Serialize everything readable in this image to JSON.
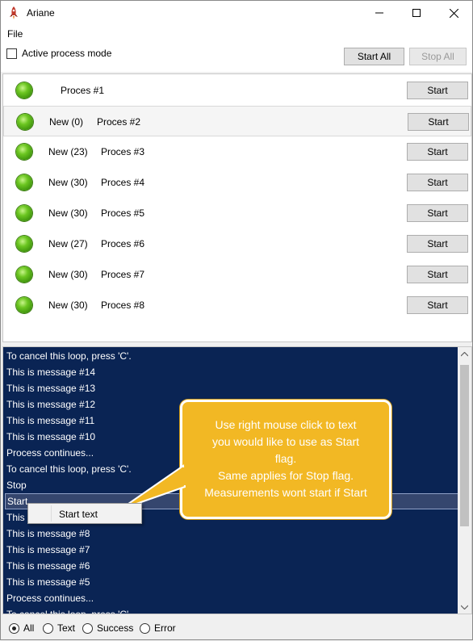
{
  "window": {
    "title": "Ariane"
  },
  "menu": {
    "file": "File"
  },
  "controls": {
    "active_mode_label": "Active process mode",
    "start_all": "Start All",
    "stop_all": "Stop All"
  },
  "processes": [
    {
      "count": "",
      "name": "Proces #1",
      "button": "Start"
    },
    {
      "count": "New (0)",
      "name": "Proces #2",
      "button": "Start"
    },
    {
      "count": "New (23)",
      "name": "Proces #3",
      "button": "Start"
    },
    {
      "count": "New (30)",
      "name": "Proces #4",
      "button": "Start"
    },
    {
      "count": "New (30)",
      "name": "Proces #5",
      "button": "Start"
    },
    {
      "count": "New (27)",
      "name": "Proces #6",
      "button": "Start"
    },
    {
      "count": "New (30)",
      "name": "Proces #7",
      "button": "Start"
    },
    {
      "count": "New (30)",
      "name": "Proces #8",
      "button": "Start"
    }
  ],
  "log": {
    "lines": [
      "To cancel this loop, press 'C'.",
      "This is message #14",
      "This is message #13",
      "This is message #12",
      "This is message #11",
      "This is message #10",
      "Process continues...",
      "To cancel this loop, press 'C'.",
      "Stop",
      "Start",
      "This is message #9",
      "This is message #8",
      "This is message #7",
      "This is message #6",
      "This is message #5",
      "Process continues...",
      "To cancel this loop, press 'C'."
    ]
  },
  "context_menu": {
    "item": "Start text"
  },
  "callout": {
    "lines": [
      "Use right mouse click to text",
      "you would like to use as Start",
      "flag.",
      "Same applies for Stop flag.",
      "Measurements wont start if Start"
    ]
  },
  "filters": [
    {
      "label": "All",
      "checked": true
    },
    {
      "label": "Text",
      "checked": false
    },
    {
      "label": "Success",
      "checked": false
    },
    {
      "label": "Error",
      "checked": false
    }
  ],
  "colors": {
    "log_background": "#0a2454",
    "callout": "#f2b824",
    "led": "#4caf1a"
  }
}
